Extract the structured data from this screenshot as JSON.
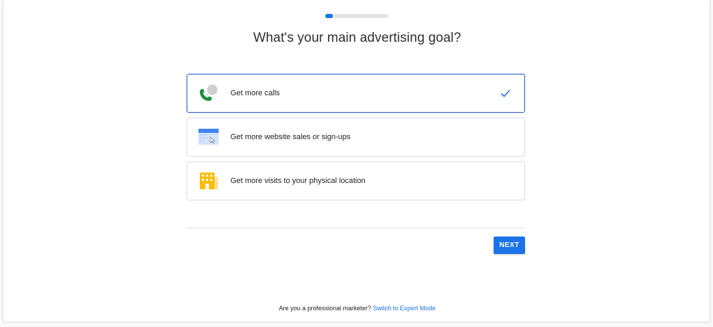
{
  "progress": {
    "value": 0.12
  },
  "header": {
    "title": "What's your main advertising goal?"
  },
  "options": [
    {
      "label": "Get more calls",
      "icon": "phone-chat-icon",
      "selected": true
    },
    {
      "label": "Get more website sales or sign-ups",
      "icon": "browser-window-icon",
      "selected": false
    },
    {
      "label": "Get more visits to your physical location",
      "icon": "storefront-icon",
      "selected": false
    }
  ],
  "actions": {
    "next_label": "NEXT"
  },
  "footer": {
    "question": "Are you a professional marketer?",
    "link_label": "Switch to Expert Mode"
  },
  "colors": {
    "accent": "#1a73e8",
    "selected_border": "#1a56c5",
    "phone_green": "#1e8e3e",
    "store_yellow": "#fbbc04"
  }
}
